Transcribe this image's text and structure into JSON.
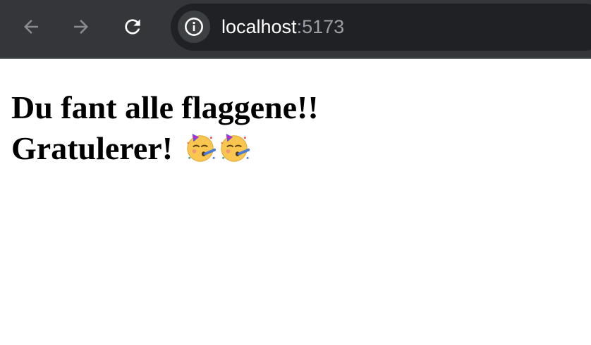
{
  "browser": {
    "url_host": "localhost",
    "url_port": ":5173"
  },
  "page": {
    "line1": "Du fant alle flaggene!!",
    "line2": "Gratulerer!",
    "emojis": [
      "partying-face-icon",
      "partying-face-icon"
    ]
  }
}
